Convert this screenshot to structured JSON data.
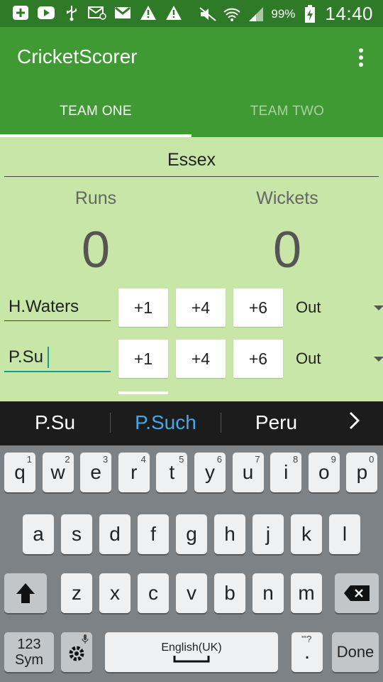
{
  "status_bar": {
    "icons": [
      "plus-box-icon",
      "youtube-icon",
      "usb-icon",
      "mail-at-icon",
      "gmail-icon",
      "warning-icon",
      "warning-icon",
      "mute-icon",
      "wifi-icon",
      "signal-icon",
      "battery-charging-icon"
    ],
    "battery": "99%",
    "time": "14:40"
  },
  "app": {
    "title": "CricketScorer",
    "tabs": [
      {
        "label": "TEAM ONE",
        "selected": true
      },
      {
        "label": "TEAM TWO",
        "selected": false
      }
    ]
  },
  "main": {
    "team_name": "Essex",
    "runs_label": "Runs",
    "wickets_label": "Wickets",
    "runs": "0",
    "wickets": "0",
    "players": [
      {
        "name": "H.Waters",
        "btn1": "+1",
        "btn4": "+4",
        "btn6": "+6",
        "status": "Out"
      },
      {
        "name": "P.Su",
        "btn1": "+1",
        "btn4": "+4",
        "btn6": "+6",
        "status": "Out"
      }
    ]
  },
  "suggestions": [
    "P.Su",
    "P.Such",
    "Peru"
  ],
  "keyboard": {
    "row1": [
      {
        "k": "q",
        "h": "1"
      },
      {
        "k": "w",
        "h": "2"
      },
      {
        "k": "e",
        "h": "3"
      },
      {
        "k": "r",
        "h": "4"
      },
      {
        "k": "t",
        "h": "5"
      },
      {
        "k": "y",
        "h": "6"
      },
      {
        "k": "u",
        "h": "7"
      },
      {
        "k": "i",
        "h": "8"
      },
      {
        "k": "o",
        "h": "9"
      },
      {
        "k": "p",
        "h": "0"
      }
    ],
    "row2": [
      "a",
      "s",
      "d",
      "f",
      "g",
      "h",
      "j",
      "k",
      "l"
    ],
    "row3": [
      "z",
      "x",
      "c",
      "v",
      "b",
      "n",
      "m"
    ],
    "sym_top": "123",
    "sym_bottom": "Sym",
    "space_label": "English(UK)",
    "period_hint": "'\"?",
    "period": ".",
    "done": "Done"
  },
  "colors": {
    "status_bar": "#2f7a26",
    "app_bar": "#3f9a34",
    "content_bg": "#c8e6a8",
    "suggestion_highlight": "#43a7e8",
    "input_accent": "#1e9a8a"
  }
}
